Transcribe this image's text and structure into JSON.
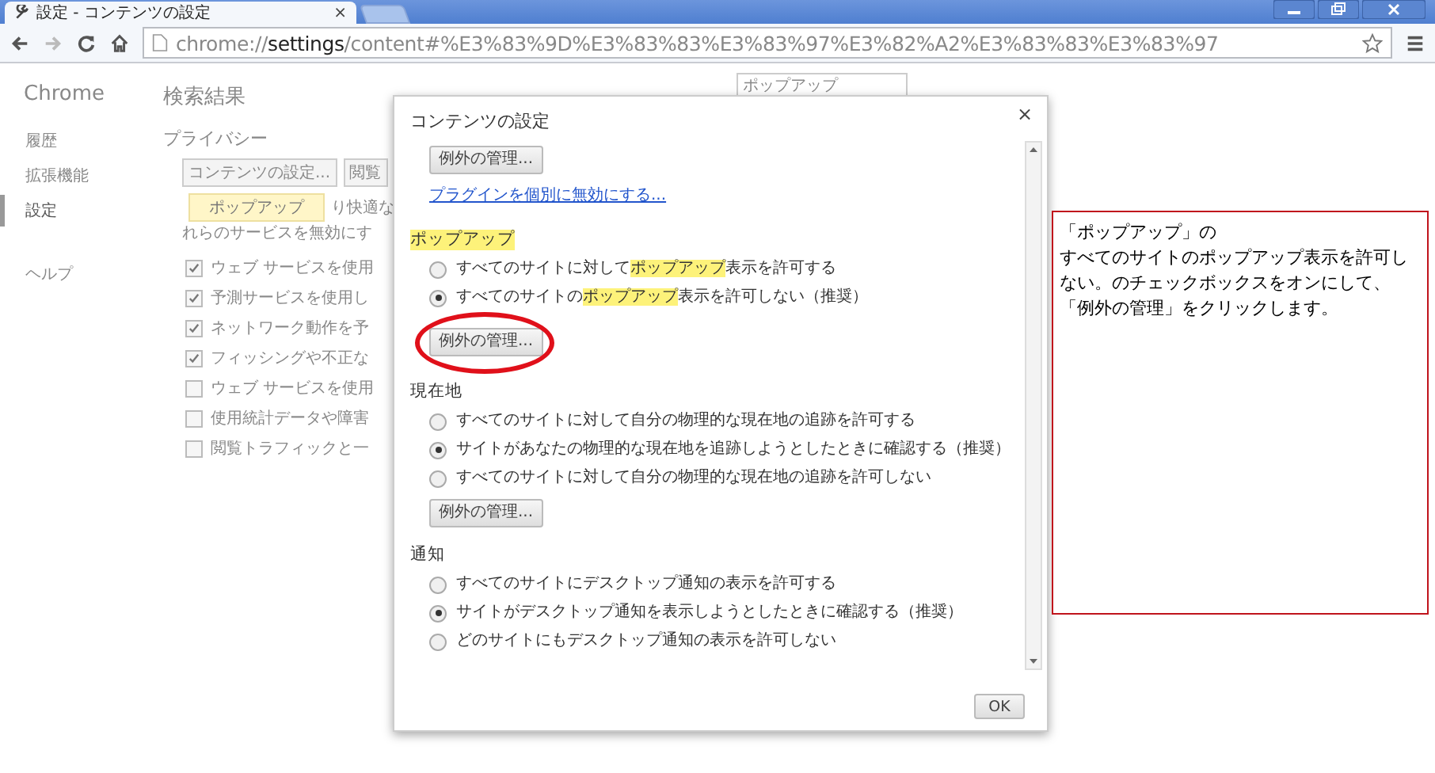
{
  "browser": {
    "tab": {
      "title": "設定 - コンテンツの設定",
      "close": "×",
      "selected": true
    },
    "url": {
      "scheme": "chrome://",
      "host": "settings",
      "path": "/content#%E3%83%9D%E3%83%83%E3%83%97%E3%82%A2%E3%83%83%E3%83%97"
    }
  },
  "settings_page": {
    "sidebar": {
      "title": "Chrome",
      "items": [
        {
          "label": "履歴",
          "selected": false
        },
        {
          "label": "拡張機能",
          "selected": false
        },
        {
          "label": "設定",
          "selected": true
        },
        {
          "label": "ヘルプ",
          "selected": false
        }
      ]
    },
    "heading": "検索結果",
    "search": {
      "value": "ポップアップ"
    },
    "section": "プライバシー",
    "buttons": [
      "コンテンツの設定...",
      "閲覧"
    ],
    "tooltip": "ポップアップ",
    "description": [
      "り快適な",
      "れらのサービスを無効にす"
    ],
    "checkboxes": [
      {
        "label": "ウェブ サービスを使用",
        "checked": true
      },
      {
        "label": "予測サービスを使用し",
        "checked": true
      },
      {
        "label": "ネットワーク動作を予",
        "checked": true
      },
      {
        "label": "フィッシングや不正な",
        "checked": true
      },
      {
        "label": "ウェブ サービスを使用",
        "checked": false
      },
      {
        "label": "使用統計データや障害",
        "checked": false
      },
      {
        "label": "閲覧トラフィックと一",
        "checked": false
      }
    ]
  },
  "dialog": {
    "title": "コンテンツの設定",
    "close": "×",
    "items": [
      {
        "kind": "button",
        "label": "例外の管理...",
        "circled": false
      },
      {
        "kind": "link",
        "label": "プラグインを個別に無効にする..."
      },
      {
        "kind": "heading",
        "label": "ポップアップ",
        "highlighted": true
      },
      {
        "kind": "radio",
        "selected": false,
        "segments": [
          {
            "text": "すべてのサイトに対して",
            "highlighted": false
          },
          {
            "text": "ポップアップ",
            "highlighted": true
          },
          {
            "text": "表示を許可する",
            "highlighted": false
          }
        ]
      },
      {
        "kind": "radio",
        "selected": true,
        "segments": [
          {
            "text": "すべてのサイトの",
            "highlighted": false
          },
          {
            "text": "ポップアップ",
            "highlighted": true
          },
          {
            "text": "表示を許可しない（推奨）",
            "highlighted": false
          }
        ]
      },
      {
        "kind": "button",
        "label": "例外の管理...",
        "circled": true
      },
      {
        "kind": "heading",
        "label": "現在地",
        "highlighted": false
      },
      {
        "kind": "radio",
        "selected": false,
        "segments": [
          {
            "text": "すべてのサイトに対して自分の物理的な現在地の追跡を許可する",
            "highlighted": false
          }
        ]
      },
      {
        "kind": "radio",
        "selected": true,
        "segments": [
          {
            "text": "サイトがあなたの物理的な現在地を追跡しようとしたときに確認する（推奨）",
            "highlighted": false
          }
        ]
      },
      {
        "kind": "radio",
        "selected": false,
        "segments": [
          {
            "text": "すべてのサイトに対して自分の物理的な現在地の追跡を許可しない",
            "highlighted": false
          }
        ]
      },
      {
        "kind": "button",
        "label": "例外の管理...",
        "circled": false
      },
      {
        "kind": "heading",
        "label": "通知",
        "highlighted": false
      },
      {
        "kind": "radio",
        "selected": false,
        "segments": [
          {
            "text": "すべてのサイトにデスクトップ通知の表示を許可する",
            "highlighted": false
          }
        ]
      },
      {
        "kind": "radio",
        "selected": true,
        "segments": [
          {
            "text": "サイトがデスクトップ通知を表示しようとしたときに確認する（推奨）",
            "highlighted": false
          }
        ]
      },
      {
        "kind": "radio",
        "selected": false,
        "segments": [
          {
            "text": "どのサイトにもデスクトップ通知の表示を許可しない",
            "highlighted": false
          }
        ]
      }
    ],
    "ok": "OK"
  },
  "callout": {
    "lines": [
      "「ポップアップ」の",
      "すべてのサイトのポップアップ表示を許可し",
      "ない。のチェックボックスをオンにして、",
      "「例外の管理」をクリックします。"
    ]
  }
}
